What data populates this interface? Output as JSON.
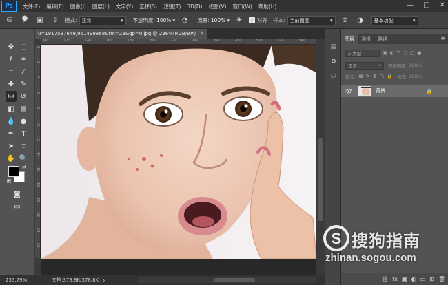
{
  "app": {
    "logo": "Ps"
  },
  "menu": [
    "文件(F)",
    "编辑(E)",
    "图像(I)",
    "图层(L)",
    "文字(Y)",
    "选择(S)",
    "滤镜(T)",
    "3D(D)",
    "视图(V)",
    "窗口(W)",
    "帮助(H)"
  ],
  "window_controls": {
    "minimize": "—",
    "maximize": "□",
    "close": "✕"
  },
  "options": {
    "brush_size": "21",
    "mode_label": "模式:",
    "mode_value": "正常",
    "opacity_label": "不透明度:",
    "opacity_value": "100%",
    "flow_label": "流量:",
    "flow_value": "100%",
    "aligned_label": "对齐",
    "aligned_checked": "✓",
    "sample_label": "样本:",
    "sample_value": "当前图层",
    "workspace": "基本功能"
  },
  "document": {
    "tab_title": "u=1917587649,961499868&fm=23&gp=0.jpg @ 236%(RGB/8#)",
    "close": "✕"
  },
  "ruler": {
    "top": [
      "300",
      "120",
      "140",
      "160",
      "180",
      "200",
      "220",
      "240",
      "260",
      "280",
      "300",
      "320",
      "340"
    ],
    "left": [
      "0",
      "2",
      "4",
      "6",
      "8",
      "10",
      "12",
      "14",
      "16",
      "18",
      "20",
      "22",
      "24",
      "26"
    ]
  },
  "status": {
    "zoom": "235.79%",
    "doc_info": "文档:378.8K/378.8K",
    "arrow": "›"
  },
  "panel": {
    "tabs": [
      "图层",
      "通道",
      "路径"
    ],
    "menu_icon": "≡",
    "filter_label": "ρ 类型",
    "blend_mode": "正常",
    "opacity_label": "不透明度:",
    "opacity_value": "100%",
    "lock_label": "锁定:",
    "fill_label": "填充:",
    "fill_value": "100%",
    "layer_name": "背景"
  },
  "watermark": {
    "logo_letter": "S",
    "name": "搜狗指南",
    "url": "zhinan.sogou.com"
  },
  "colors": {
    "accent": "#31a8ff",
    "panel": "#535353",
    "menubar": "#323232"
  }
}
